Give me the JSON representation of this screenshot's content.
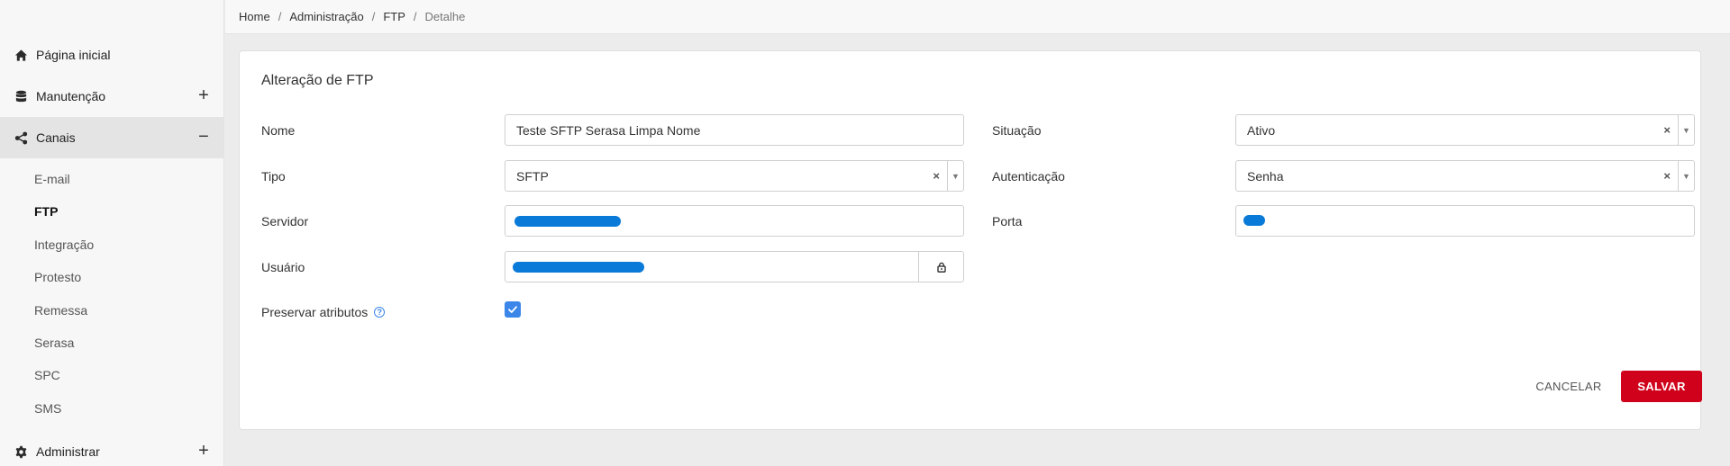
{
  "breadcrumb": {
    "items": [
      "Home",
      "Administração",
      "FTP"
    ],
    "current": "Detalhe"
  },
  "sidebar": {
    "items": [
      {
        "label": "Página inicial",
        "icon": "home-icon"
      },
      {
        "label": "Manutenção",
        "icon": "database-icon",
        "toggle": "+"
      },
      {
        "label": "Canais",
        "icon": "share-icon",
        "toggle": "−"
      },
      {
        "label": "Administrar",
        "icon": "gear-icon",
        "toggle": "+"
      }
    ],
    "subitems": [
      "E-mail",
      "FTP",
      "Integração",
      "Protesto",
      "Remessa",
      "Serasa",
      "SPC",
      "SMS"
    ],
    "selected_subitem": "FTP"
  },
  "form": {
    "title": "Alteração de FTP",
    "nome": {
      "label": "Nome",
      "value": "Teste SFTP Serasa Limpa Nome"
    },
    "situacao": {
      "label": "Situação",
      "value": "Ativo"
    },
    "tipo": {
      "label": "Tipo",
      "value": "SFTP"
    },
    "autenticacao": {
      "label": "Autenticação",
      "value": "Senha"
    },
    "servidor": {
      "label": "Servidor"
    },
    "porta": {
      "label": "Porta"
    },
    "usuario": {
      "label": "Usuário"
    },
    "preservar": {
      "label": "Preservar atributos",
      "checked": true,
      "help": "?"
    },
    "clear_symbol": "×",
    "arrow_symbol": "▼"
  },
  "actions": {
    "cancel_label": "CANCELAR",
    "save_label": "SALVAR"
  },
  "colors": {
    "accent": "#3b86e8",
    "save": "#d0021b",
    "redaction": "#0a7ad9"
  }
}
